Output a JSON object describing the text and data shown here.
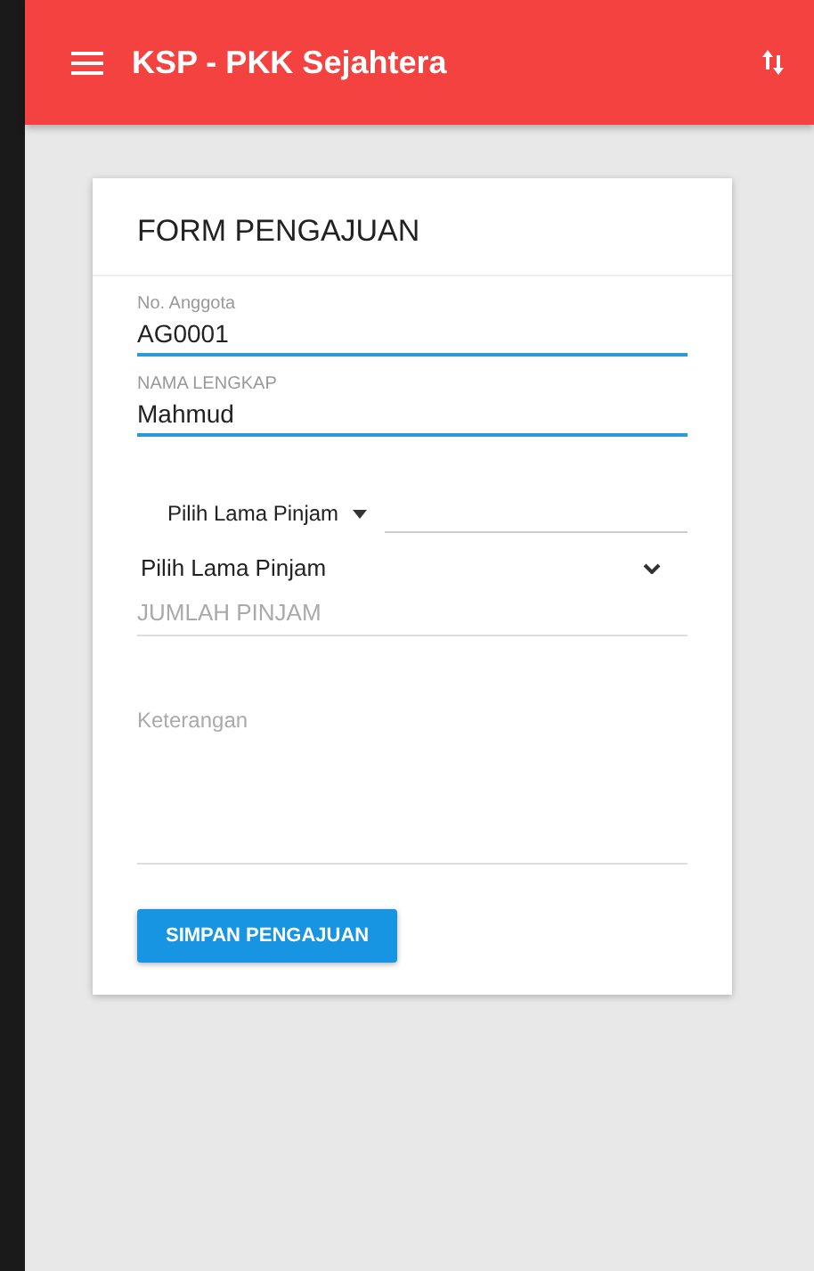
{
  "app_bar": {
    "title": "KSP - PKK Sejahtera"
  },
  "form": {
    "title": "FORM PENGAJUAN",
    "fields": [
      {
        "label": "No. Anggota",
        "value": "AG0001",
        "focused": true
      },
      {
        "label": "NAMA LENGKAP",
        "value": "Mahmud",
        "focused": true
      }
    ],
    "spinner": {
      "value": "Pilih Lama Pinjam"
    },
    "select": {
      "value": "Pilih Lama Pinjam"
    },
    "amount": {
      "placeholder": "JUMLAH PINJAM"
    },
    "notes": {
      "placeholder": "Keterangan"
    },
    "submit": "SIMPAN PENGAJUAN"
  }
}
